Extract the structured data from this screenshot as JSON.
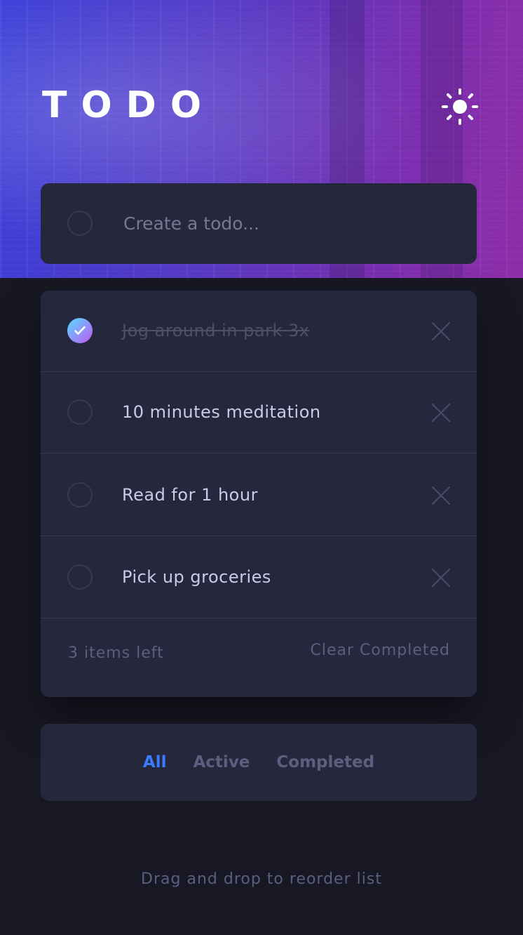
{
  "app": {
    "title": "TODO",
    "theme_icon": "sun-icon"
  },
  "create": {
    "placeholder": "Create a todo..."
  },
  "todos": [
    {
      "text": "Jog around in park 3x",
      "completed": true
    },
    {
      "text": "10 minutes meditation",
      "completed": false
    },
    {
      "text": "Read for 1 hour",
      "completed": false
    },
    {
      "text": "Pick up groceries",
      "completed": false
    }
  ],
  "footer": {
    "items_left": "3 items left",
    "clear_label": "Clear Completed"
  },
  "filters": {
    "all": "All",
    "active": "Active",
    "completed": "Completed",
    "selected": "All"
  },
  "hint": "Drag and drop to reorder list",
  "colors": {
    "background": "#171823",
    "card": "#25273d",
    "accent": "#3a7cfd",
    "check_gradient_start": "#55ddff",
    "check_gradient_end": "#c058f3",
    "text": "#c8cbe7",
    "muted": "#5b5e7e"
  }
}
